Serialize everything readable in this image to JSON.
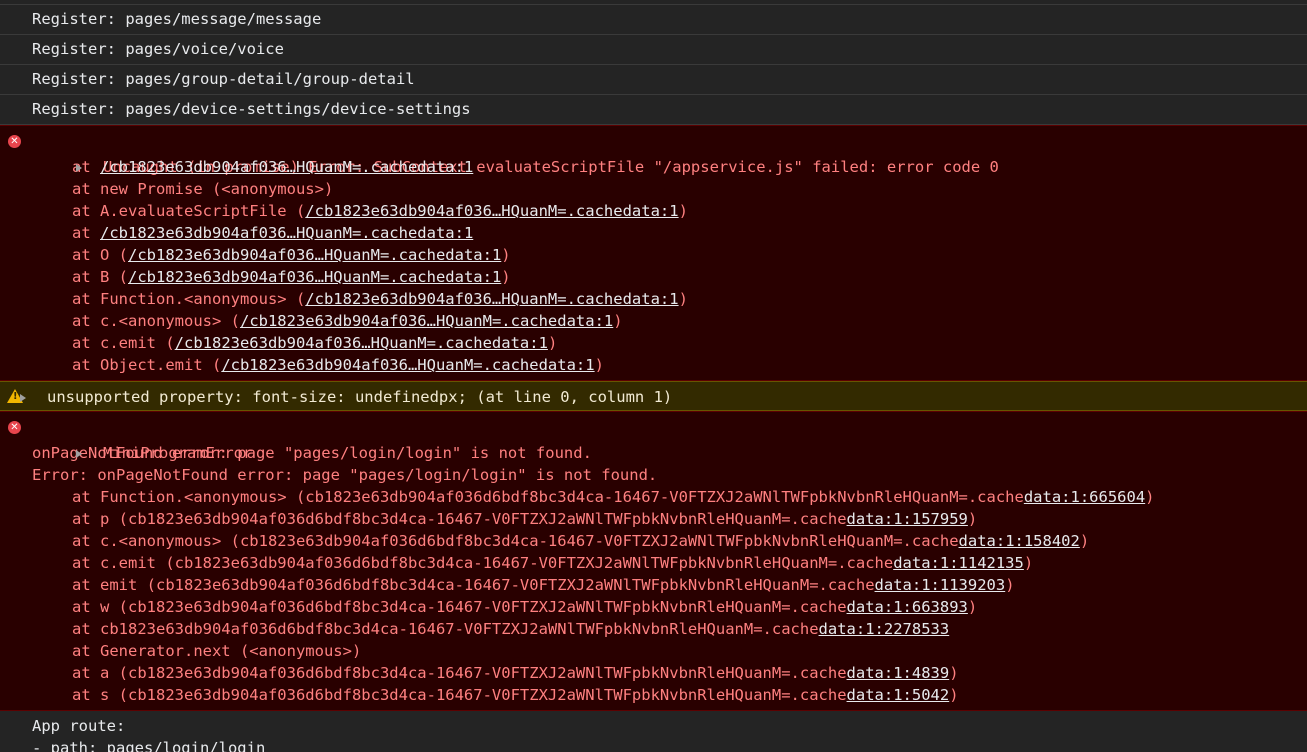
{
  "register_lines": [
    "Register: pages/message/message",
    "Register: pages/voice/voice",
    "Register: pages/group-detail/group-detail",
    "Register: pages/device-settings/device-settings"
  ],
  "error1": {
    "message": "Uncaught (in promise) Error: SubContext evaluateScriptFile \"/appservice.js\" failed: error code 0",
    "frames": [
      {
        "prefix": "at ",
        "link": "/cb1823e63db904af036…HQuanM=.cachedata:1",
        "suffix": ""
      },
      {
        "prefix": "at new Promise (<anonymous>)",
        "link": "",
        "suffix": ""
      },
      {
        "prefix": "at A.evaluateScriptFile (",
        "link": "/cb1823e63db904af036…HQuanM=.cachedata:1",
        "suffix": ")"
      },
      {
        "prefix": "at ",
        "link": "/cb1823e63db904af036…HQuanM=.cachedata:1",
        "suffix": ""
      },
      {
        "prefix": "at O (",
        "link": "/cb1823e63db904af036…HQuanM=.cachedata:1",
        "suffix": ")"
      },
      {
        "prefix": "at B (",
        "link": "/cb1823e63db904af036…HQuanM=.cachedata:1",
        "suffix": ")"
      },
      {
        "prefix": "at Function.<anonymous> (",
        "link": "/cb1823e63db904af036…HQuanM=.cachedata:1",
        "suffix": ")"
      },
      {
        "prefix": "at c.<anonymous> (",
        "link": "/cb1823e63db904af036…HQuanM=.cachedata:1",
        "suffix": ")"
      },
      {
        "prefix": "at c.emit (",
        "link": "/cb1823e63db904af036…HQuanM=.cachedata:1",
        "suffix": ")"
      },
      {
        "prefix": "at Object.emit (",
        "link": "/cb1823e63db904af036…HQuanM=.cachedata:1",
        "suffix": ")"
      }
    ]
  },
  "warning": {
    "message": "unsupported property: font-size: undefinedpx; (at line 0, column 1)"
  },
  "error2": {
    "title": "MiniProgramError",
    "lines": [
      "onPageNotFound error: page \"pages/login/login\" is not found.",
      "Error: onPageNotFound error: page \"pages/login/login\" is not found."
    ],
    "frames": [
      {
        "prefix": "at Function.<anonymous> (cb1823e63db904af036d6bdf8bc3d4ca-16467-V0FTZXJ2aWNlTWFpbkNvbnRleHQuanM=.cache",
        "link": "data:1:665604",
        "suffix": ")"
      },
      {
        "prefix": "at p (cb1823e63db904af036d6bdf8bc3d4ca-16467-V0FTZXJ2aWNlTWFpbkNvbnRleHQuanM=.cache",
        "link": "data:1:157959",
        "suffix": ")"
      },
      {
        "prefix": "at c.<anonymous> (cb1823e63db904af036d6bdf8bc3d4ca-16467-V0FTZXJ2aWNlTWFpbkNvbnRleHQuanM=.cache",
        "link": "data:1:158402",
        "suffix": ")"
      },
      {
        "prefix": "at c.emit (cb1823e63db904af036d6bdf8bc3d4ca-16467-V0FTZXJ2aWNlTWFpbkNvbnRleHQuanM=.cache",
        "link": "data:1:1142135",
        "suffix": ")"
      },
      {
        "prefix": "at emit (cb1823e63db904af036d6bdf8bc3d4ca-16467-V0FTZXJ2aWNlTWFpbkNvbnRleHQuanM=.cache",
        "link": "data:1:1139203",
        "suffix": ")"
      },
      {
        "prefix": "at w (cb1823e63db904af036d6bdf8bc3d4ca-16467-V0FTZXJ2aWNlTWFpbkNvbnRleHQuanM=.cache",
        "link": "data:1:663893",
        "suffix": ")"
      },
      {
        "prefix": "at cb1823e63db904af036d6bdf8bc3d4ca-16467-V0FTZXJ2aWNlTWFpbkNvbnRleHQuanM=.cache",
        "link": "data:1:2278533",
        "suffix": ""
      },
      {
        "prefix": "at Generator.next (<anonymous>)",
        "link": "",
        "suffix": ""
      },
      {
        "prefix": "at a (cb1823e63db904af036d6bdf8bc3d4ca-16467-V0FTZXJ2aWNlTWFpbkNvbnRleHQuanM=.cache",
        "link": "data:1:4839",
        "suffix": ")"
      },
      {
        "prefix": "at s (cb1823e63db904af036d6bdf8bc3d4ca-16467-V0FTZXJ2aWNlTWFpbkNvbnRleHQuanM=.cache",
        "link": "data:1:5042",
        "suffix": ")"
      }
    ]
  },
  "route": {
    "lines": [
      "App route:",
      "- path: pages/login/login"
    ]
  },
  "icons": {
    "error": "error-icon",
    "warning": "warning-icon",
    "expand": "expand-caret-icon"
  },
  "colors": {
    "background": "#242424",
    "error_bg": "#290000",
    "error_text": "#ff8080",
    "warning_bg": "#332a00",
    "warning_text": "#f2ead3",
    "error_icon": "#e8454d",
    "warning_icon": "#f2b600"
  }
}
